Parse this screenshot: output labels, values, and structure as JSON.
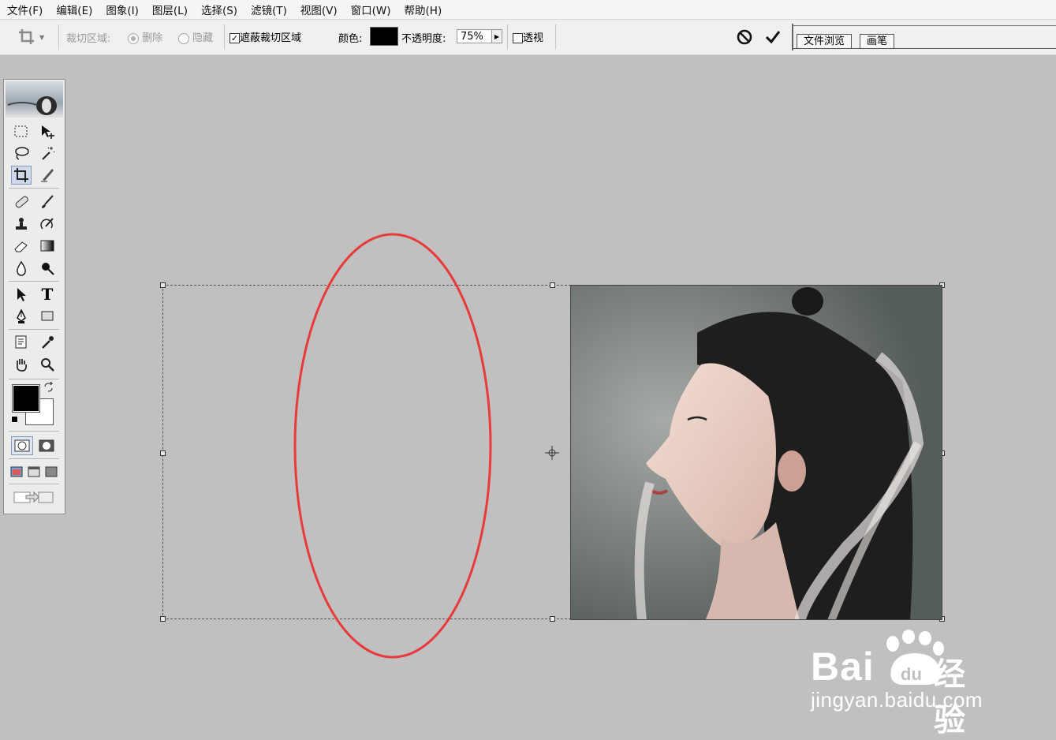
{
  "menu": [
    "文件(F)",
    "编辑(E)",
    "图象(I)",
    "图层(L)",
    "选择(S)",
    "滤镜(T)",
    "视图(V)",
    "窗口(W)",
    "帮助(H)"
  ],
  "options": {
    "crop_area_label": "裁切区域:",
    "delete_label": "删除",
    "hide_label": "隐藏",
    "shield_label": "遮蔽裁切区域",
    "shield_checked": true,
    "color_label": "颜色:",
    "shield_color": "#000000",
    "opacity_label": "不透明度:",
    "opacity_value": "75%",
    "perspective_label": "透视",
    "perspective_checked": false,
    "cancel_icon": "cancel-icon",
    "commit_icon": "checkmark-icon"
  },
  "palette_well": {
    "tabs": [
      "文件浏览",
      "画笔"
    ]
  },
  "toolbox": {
    "tools": [
      "marquee-tool",
      "move-tool",
      "lasso-tool",
      "magic-wand-tool",
      "crop-tool",
      "slice-tool",
      "healing-brush-tool",
      "brush-tool",
      "clone-stamp-tool",
      "history-brush-tool",
      "eraser-tool",
      "gradient-tool",
      "blur-tool",
      "dodge-tool",
      "path-selection-tool",
      "type-tool",
      "pen-tool",
      "shape-tool",
      "notes-tool",
      "eyedropper-tool",
      "hand-tool",
      "zoom-tool"
    ],
    "selected_tool": "crop-tool",
    "type_tool_glyph": "T",
    "foreground_color": "#000000",
    "background_color": "#ffffff"
  },
  "annotation_color": "#e83a3a",
  "watermark": {
    "brand": "Bai",
    "brand_suffix": "经验",
    "url": "jingyan.baidu.com"
  }
}
